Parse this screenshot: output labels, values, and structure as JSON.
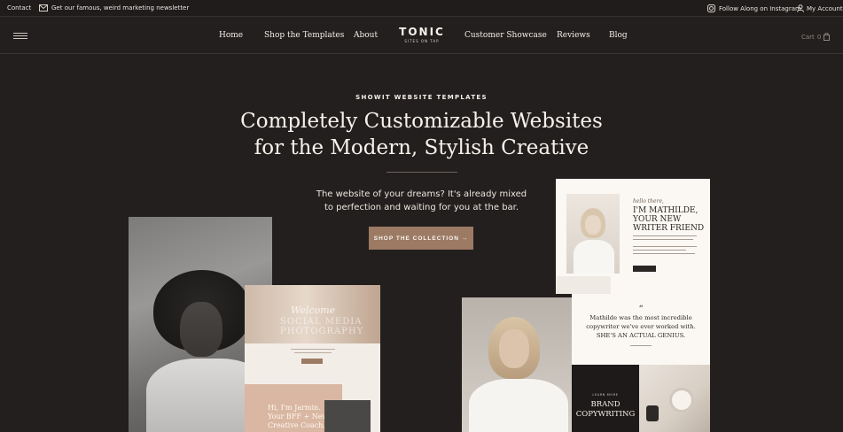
{
  "topbar": {
    "contact": "Contact",
    "newsletter": "Get our famous, weird marketing newsletter",
    "instagram": "Follow Along on Instagram",
    "account": "My Account"
  },
  "nav": {
    "items": [
      "Home",
      "Shop the Templates",
      "About",
      "Customer Showcase",
      "Reviews",
      "Blog"
    ],
    "logo": "TONIC",
    "logo_tagline": "SITES ON TAP",
    "cart_label": "Cart",
    "cart_count": "0"
  },
  "hero": {
    "eyebrow": "SHOWIT WEBSITE TEMPLATES",
    "headline_line1": "Completely Customizable Websites",
    "headline_line2": "for the Modern, Stylish Creative",
    "sub_line1": "The website of your dreams? It's already mixed",
    "sub_line2": "to perfection and waiting for you at the bar.",
    "cta": "SHOP THE COLLECTION →"
  },
  "mockups": {
    "left_site_script": "Welcome",
    "left_site_big": "SOCIAL MEDIA PHOTOGRAPHY",
    "left_site_panel_line1": "Hi, I'm Jarmin.",
    "left_site_panel_line2": "Your BFF + New",
    "left_site_panel_line3": "Creative Coach.",
    "right_site_script": "hello there,",
    "right_site_head_line1": "I'M MATHILDE,",
    "right_site_head_line2": "YOUR NEW",
    "right_site_head_line3": "WRITER FRIEND",
    "quote_mark": "“",
    "quote_line1": "Mathilde was the most incredible",
    "quote_line2": "copywriter we've ever worked with.",
    "quote_line3": "SHE'S AN ACTUAL GENIUS.",
    "brand_small": "LEARN MORE",
    "brand_line1": "BRAND",
    "brand_line2": "COPYWRITING"
  },
  "colors": {
    "background": "#231f1e",
    "accent": "#9c7a64"
  }
}
